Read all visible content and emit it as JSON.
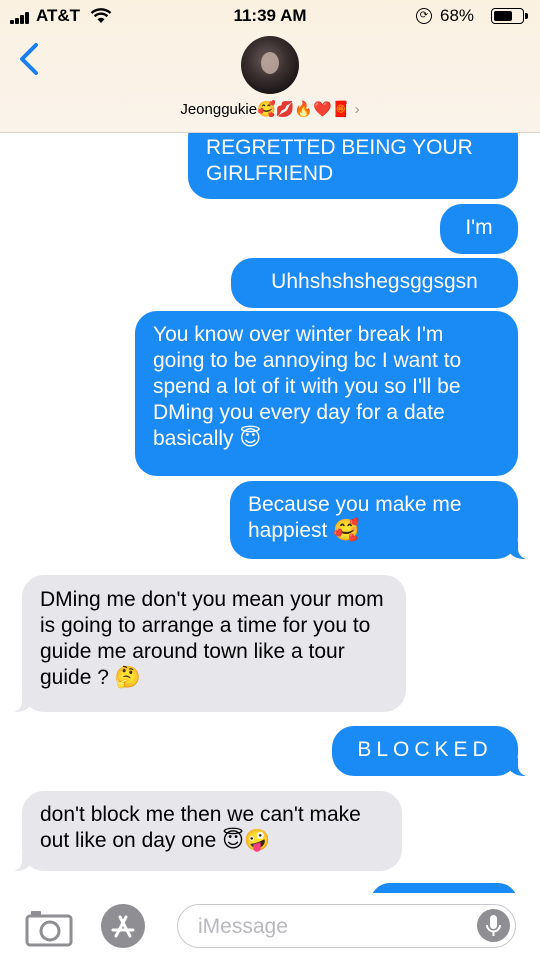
{
  "status_bar": {
    "carrier": "AT&T",
    "time": "11:39 AM",
    "battery_percent": "68%",
    "battery_level": 0.68
  },
  "header": {
    "contact_name": "Jeonggukie🥰💋🔥❤️🧧",
    "chevron": "›",
    "back_icon": "chevron-left-icon"
  },
  "messages": [
    {
      "from": "me",
      "text": "REGRETTED BEING YOUR GIRLFRIEND"
    },
    {
      "from": "me",
      "text": "I'm"
    },
    {
      "from": "me",
      "text": "Uhhshshshegsggsgsn"
    },
    {
      "from": "me",
      "text": "You know over winter break I'm going to be annoying bc I want to spend a lot of it with you so I'll be DMing you every day for a date basically 😇"
    },
    {
      "from": "me",
      "text": "Because you make me happiest 🥰"
    },
    {
      "from": "them",
      "text": "DMing me don't you mean your mom is going to arrange a time for you to guide me around town like a tour guide ? 🤔"
    },
    {
      "from": "me",
      "text": "BLOCKED"
    },
    {
      "from": "them",
      "text": "don't block me then we can't make out like on day one 😇🤪"
    }
  ],
  "input": {
    "placeholder": "iMessage"
  },
  "colors": {
    "sent_bubble": "#1a8af5",
    "received_bubble": "#e6e6eb",
    "header_bg": "#fbf1e1"
  }
}
